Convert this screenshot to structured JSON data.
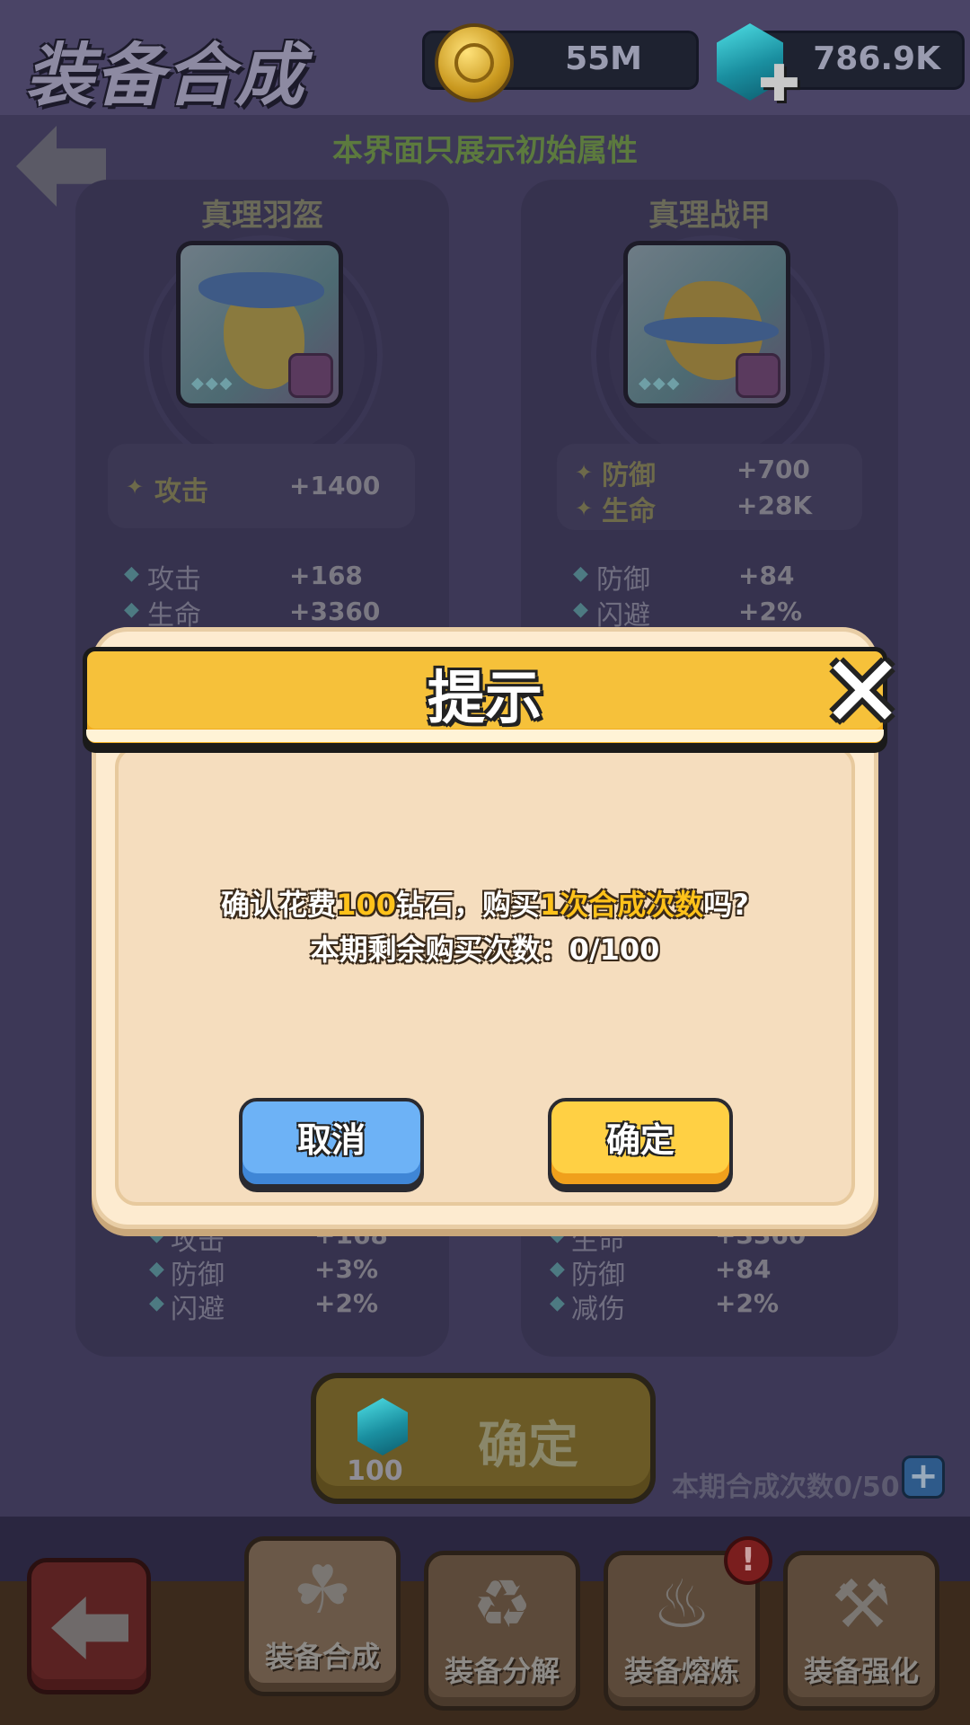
{
  "header": {
    "title": "装备合成",
    "gold": {
      "icon": "coin-icon",
      "value": "55M"
    },
    "gems": {
      "icon": "gem-icon",
      "value": "786.9K",
      "add_icon": "plus-icon"
    }
  },
  "subtitle": "本界面只展示初始属性",
  "left_item": {
    "name": "真理羽盔",
    "main_stats": [
      {
        "label": "攻击",
        "value": "+1400"
      }
    ],
    "sub_stats": [
      {
        "label": "攻击",
        "value": "+168"
      },
      {
        "label": "生命",
        "value": "+3360"
      }
    ],
    "lower_stats": [
      {
        "label": "攻击",
        "value": "+168"
      },
      {
        "label": "防御",
        "value": "+3%"
      },
      {
        "label": "闪避",
        "value": "+2%"
      }
    ]
  },
  "right_item": {
    "name": "真理战甲",
    "main_stats": [
      {
        "label": "防御",
        "value": "+700"
      },
      {
        "label": "生命",
        "value": "+28K"
      }
    ],
    "sub_stats": [
      {
        "label": "防御",
        "value": "+84"
      },
      {
        "label": "闪避",
        "value": "+2%"
      }
    ],
    "lower_stats": [
      {
        "label": "生命",
        "value": "+3360"
      },
      {
        "label": "防御",
        "value": "+84"
      },
      {
        "label": "减伤",
        "value": "+2%"
      }
    ]
  },
  "confirm_button": {
    "label": "确定",
    "cost": "100"
  },
  "craft_count_text": "本期合成次数0/50",
  "nav": {
    "tabs": [
      {
        "label": "装备合成",
        "icon": "triquetra-icon"
      },
      {
        "label": "装备分解",
        "icon": "recycle-icon"
      },
      {
        "label": "装备熔炼",
        "icon": "furnace-icon"
      },
      {
        "label": "装备强化",
        "icon": "anvil-icon"
      }
    ],
    "alert_badge": "!"
  },
  "dialog": {
    "title": "提示",
    "line1": {
      "pre": "确认花费",
      "hl1": "100",
      "mid": "钻石，购买",
      "hl2": "1次合成次数",
      "post": "吗?"
    },
    "line2": "本期剩余购买次数：0/100",
    "cancel_label": "取消",
    "ok_label": "确定"
  },
  "colors": {
    "dialog_header": "#f6c13a",
    "dialog_body": "#fdebd0",
    "highlight": "#ffc21a",
    "cancel_button": "#6db2f6",
    "ok_button": "#ffd044"
  }
}
